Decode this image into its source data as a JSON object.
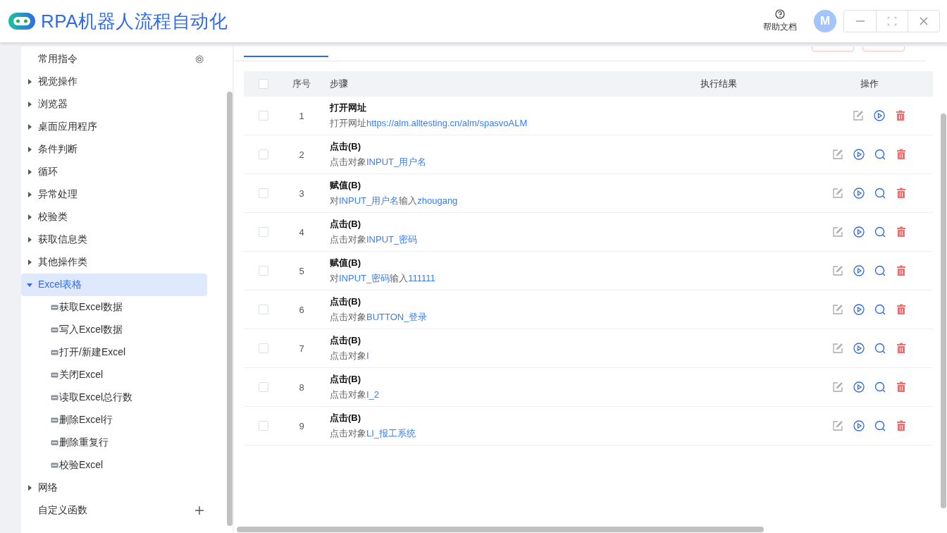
{
  "app": {
    "title": "RPA机器人流程自动化",
    "help": "帮助文档",
    "avatar": "M"
  },
  "sidebar": {
    "items": [
      {
        "kind": "header",
        "label": "常用指令"
      },
      {
        "kind": "group",
        "label": "视觉操作",
        "expanded": false,
        "selected": false
      },
      {
        "kind": "group",
        "label": "浏览器",
        "expanded": false,
        "selected": false
      },
      {
        "kind": "group",
        "label": "桌面应用程序",
        "expanded": false,
        "selected": false
      },
      {
        "kind": "group",
        "label": "条件判断",
        "expanded": false,
        "selected": false
      },
      {
        "kind": "group",
        "label": "循环",
        "expanded": false,
        "selected": false
      },
      {
        "kind": "group",
        "label": "异常处理",
        "expanded": false,
        "selected": false
      },
      {
        "kind": "group",
        "label": "校验类",
        "expanded": false,
        "selected": false
      },
      {
        "kind": "group",
        "label": "获取信息类",
        "expanded": false,
        "selected": false
      },
      {
        "kind": "group",
        "label": "其他操作类",
        "expanded": false,
        "selected": false
      },
      {
        "kind": "group",
        "label": "Excel表格",
        "expanded": true,
        "selected": true,
        "children": [
          {
            "label": "获取Excel数据"
          },
          {
            "label": "写入Excel数据"
          },
          {
            "label": "打开/新建Excel"
          },
          {
            "label": "关闭Excel"
          },
          {
            "label": "读取Excel总行数"
          },
          {
            "label": "删除Excel行"
          },
          {
            "label": "删除重复行"
          },
          {
            "label": "校验Excel"
          }
        ]
      },
      {
        "kind": "group",
        "label": "网络",
        "expanded": false,
        "selected": false
      },
      {
        "kind": "custom",
        "label": "自定义函数"
      }
    ]
  },
  "table": {
    "select_all_checked": false,
    "columns": [
      "序号",
      "步骤",
      "执行结果",
      "操作"
    ],
    "rows": [
      {
        "index": "1",
        "checked": false,
        "title": "打开网址",
        "has_locate": false,
        "desc": [
          {
            "kind": "text",
            "text": "打开网址"
          },
          {
            "kind": "link",
            "text": "https://alm.alltesting.cn/alm/spasvoALM"
          }
        ]
      },
      {
        "index": "2",
        "checked": false,
        "title": "点击(B)",
        "has_locate": true,
        "desc": [
          {
            "kind": "text",
            "text": "点击对象"
          },
          {
            "kind": "link",
            "text": "INPUT_用户名"
          }
        ]
      },
      {
        "index": "3",
        "checked": false,
        "title": "赋值(B)",
        "has_locate": true,
        "desc": [
          {
            "kind": "text",
            "text": "对"
          },
          {
            "kind": "link",
            "text": "INPUT_用户名"
          },
          {
            "kind": "text",
            "text": "输入"
          },
          {
            "kind": "link",
            "text": "zhougang"
          }
        ]
      },
      {
        "index": "4",
        "checked": false,
        "title": "点击(B)",
        "has_locate": true,
        "desc": [
          {
            "kind": "text",
            "text": "点击对象"
          },
          {
            "kind": "link",
            "text": "INPUT_密码"
          }
        ]
      },
      {
        "index": "5",
        "checked": false,
        "title": "赋值(B)",
        "has_locate": true,
        "desc": [
          {
            "kind": "text",
            "text": "对"
          },
          {
            "kind": "link",
            "text": "INPUT_密码"
          },
          {
            "kind": "text",
            "text": "输入"
          },
          {
            "kind": "link",
            "text": "111111"
          }
        ]
      },
      {
        "index": "6",
        "checked": false,
        "title": "点击(B)",
        "has_locate": true,
        "desc": [
          {
            "kind": "text",
            "text": "点击对象"
          },
          {
            "kind": "link",
            "text": "BUTTON_登录"
          }
        ]
      },
      {
        "index": "7",
        "checked": false,
        "title": "点击(B)",
        "has_locate": true,
        "desc": [
          {
            "kind": "text",
            "text": "点击对象"
          },
          {
            "kind": "link",
            "text": "I"
          }
        ]
      },
      {
        "index": "8",
        "checked": false,
        "title": "点击(B)",
        "has_locate": true,
        "desc": [
          {
            "kind": "text",
            "text": "点击对象"
          },
          {
            "kind": "link",
            "text": "I_2"
          }
        ]
      },
      {
        "index": "9",
        "checked": false,
        "title": "点击(B)",
        "has_locate": true,
        "desc": [
          {
            "kind": "text",
            "text": "点击对象"
          },
          {
            "kind": "link",
            "text": "LI_报工系统"
          }
        ]
      }
    ]
  }
}
